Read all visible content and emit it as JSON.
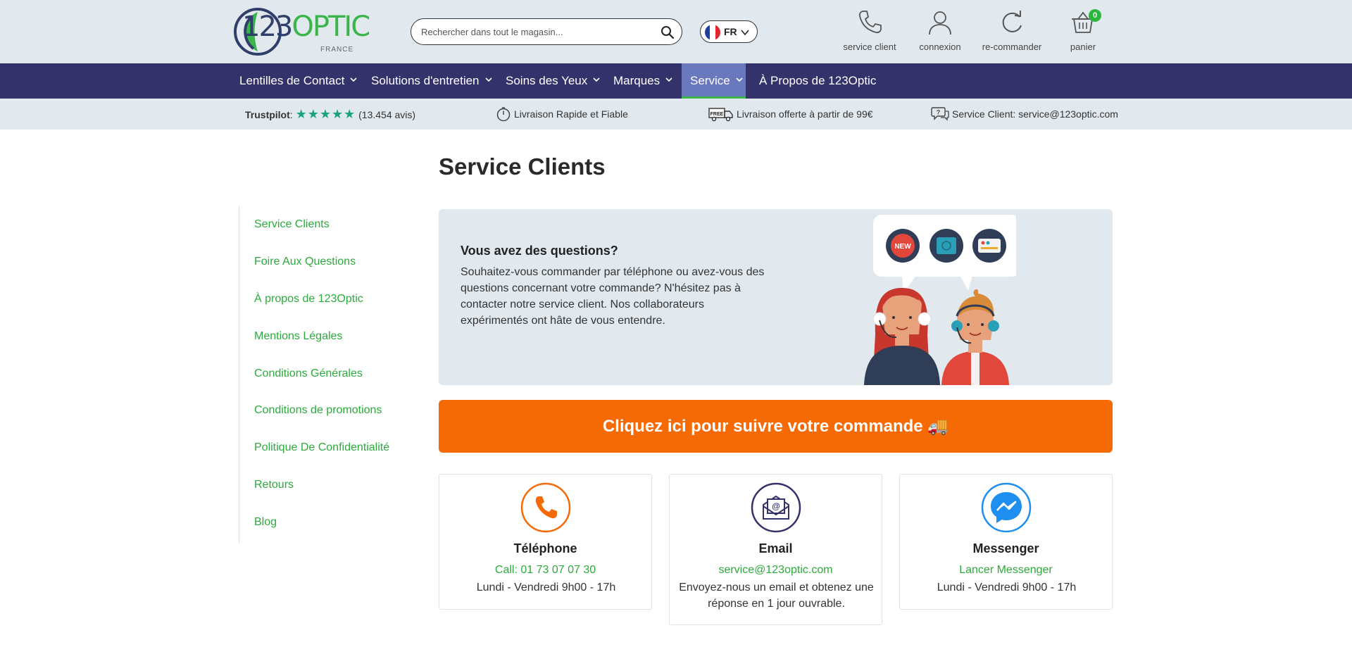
{
  "header": {
    "logo": {
      "text_main": "123",
      "text_accent": "OPTIC",
      "sub": "FRANCE"
    },
    "search": {
      "placeholder": "Rechercher dans tout le magasin..."
    },
    "language": {
      "code": "FR"
    },
    "icons": [
      {
        "label": "service client",
        "icon": "phone-icon"
      },
      {
        "label": "connexion",
        "icon": "user-icon"
      },
      {
        "label": "re-commander",
        "icon": "reorder-icon"
      },
      {
        "label": "panier",
        "icon": "cart-icon",
        "badge": "0"
      }
    ]
  },
  "nav": {
    "items": [
      {
        "label": "Lentilles de Contact",
        "dropdown": true
      },
      {
        "label": "Solutions d'entretien",
        "dropdown": true
      },
      {
        "label": "Soins des Yeux",
        "dropdown": true
      },
      {
        "label": "Marques",
        "dropdown": true
      },
      {
        "label": "Service",
        "dropdown": true,
        "active": true
      },
      {
        "label": "À Propos de 123Optic",
        "dropdown": false
      }
    ]
  },
  "trust": {
    "trustpilot_label": "Trustpilot",
    "stars": "★★★★★",
    "reviews": "(13.454 avis)",
    "delivery": "Livraison Rapide et Fiable",
    "free_shipping": "Livraison offerte à partir de 99€",
    "free_badge": "FREE",
    "service": "Service Client: service@123optic.com"
  },
  "main": {
    "title": "Service Clients",
    "sidebar": [
      "Service Clients",
      "Foire Aux Questions",
      "À propos de 123Optic",
      "Mentions Légales",
      "Conditions Générales",
      "Conditions de promotions",
      "Politique De Confidentialité",
      "Retours",
      "Blog"
    ],
    "questions": {
      "heading": "Vous avez des questions?",
      "text": "Souhaitez-vous commander par téléphone ou avez-vous des questions concernant votre commande? N'hésitez pas à contacter notre service client. Nos collaborateurs expérimentés ont hâte de vous entendre.",
      "illustration_badge": "NEW"
    },
    "track_button": "Cliquez ici pour suivre votre commande 🚚",
    "cards": [
      {
        "title": "Téléphone",
        "line1": "Call: 01 73 07 07 30",
        "line2": "Lundi - Vendredi 9h00 - 17h",
        "icon": "phone-icon"
      },
      {
        "title": "Email",
        "line1": "service@123optic.com",
        "line2": "Envoyez-nous un email et obtenez une réponse en 1 jour ouvrable.",
        "icon": "email-icon"
      },
      {
        "title": "Messenger",
        "line1": "Lancer Messenger",
        "line2": "Lundi - Vendredi 9h00 - 17h",
        "icon": "messenger-icon"
      }
    ]
  },
  "colors": {
    "brand_navy": "#33326b",
    "brand_green": "#2bab3b",
    "accent_orange": "#f66a06",
    "header_bg": "#e1e9ef",
    "nav_active": "#6a78bd",
    "messenger_blue": "#1f8ef1"
  }
}
